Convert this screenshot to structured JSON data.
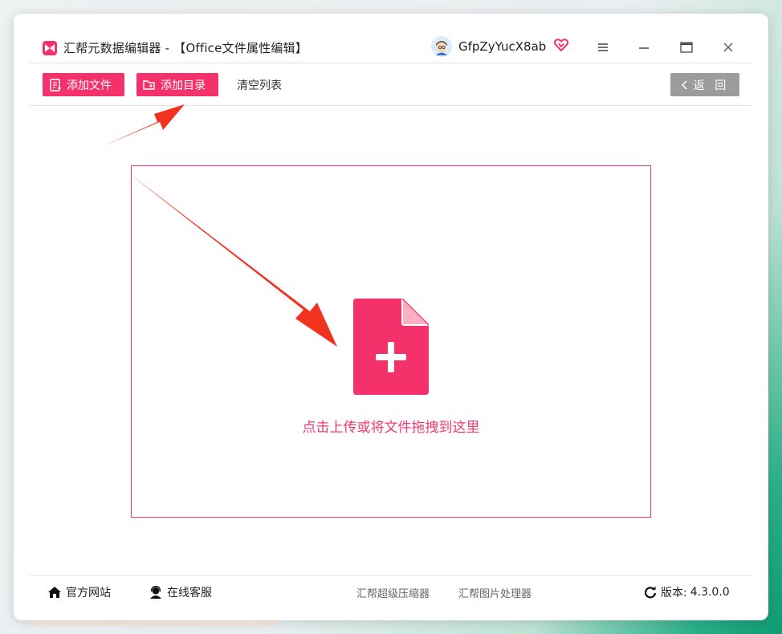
{
  "window": {
    "title": "汇帮元数据编辑器 - 【Office文件属性编辑】",
    "username": "GfpZyYucX8ab"
  },
  "toolbar": {
    "add_file": "添加文件",
    "add_folder": "添加目录",
    "clear_list": "清空列表",
    "back": "返 回"
  },
  "dropzone": {
    "text": "点击上传或将文件拖拽到这里"
  },
  "footer": {
    "official_site": "官方网站",
    "online_service": "在线客服",
    "compressor": "汇帮超级压缩器",
    "image_processor": "汇帮图片处理器",
    "version_label": "版本:",
    "version": "4.3.0.0"
  },
  "colors": {
    "accent": "#f5316b",
    "arrow": "#f1321f",
    "back_button": "#9c9c9c"
  },
  "icons": [
    "app-logo-icon",
    "avatar-icon",
    "vip-heart-icon",
    "menu-icon",
    "minimize-icon",
    "maximize-icon",
    "close-icon",
    "add-file-icon",
    "add-folder-icon",
    "chevron-left-icon",
    "file-plus-icon",
    "home-icon",
    "support-icon",
    "refresh-icon"
  ]
}
